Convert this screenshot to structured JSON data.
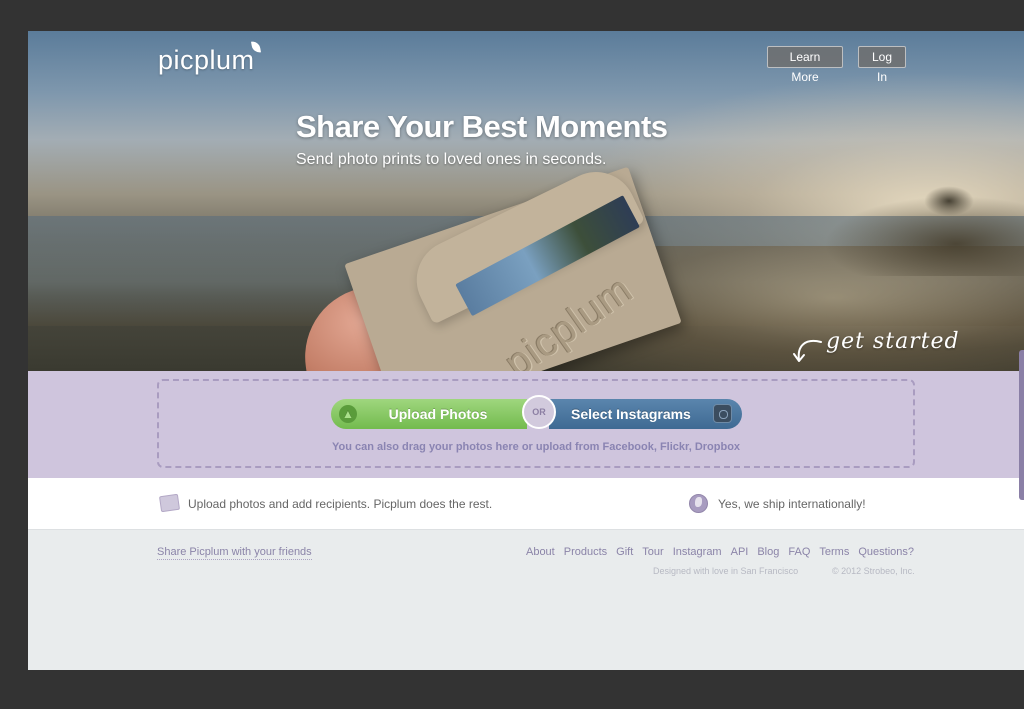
{
  "header": {
    "logo": "picplum",
    "learn_more": "Learn More",
    "log_in": "Log In"
  },
  "hero": {
    "title": "Share Your Best Moments",
    "subtitle": "Send photo prints to loved ones in seconds.",
    "card_brand": "picplum",
    "get_started": "get started"
  },
  "upload": {
    "upload_photos": "Upload Photos",
    "or": "OR",
    "select_instagrams": "Select Instagrams",
    "drag_text": "You can also drag your photos here or upload from Facebook, Flickr, Dropbox"
  },
  "info": {
    "left": "Upload photos and add recipients. Picplum does the rest.",
    "right": "Yes, we ship internationally!"
  },
  "footer": {
    "share": "Share Picplum with your friends",
    "nav": [
      "About",
      "Products",
      "Gift",
      "Tour",
      "Instagram",
      "API",
      "Blog",
      "FAQ",
      "Terms",
      "Questions?"
    ],
    "designed": "Designed with love in San Francisco",
    "copyright": "© 2012 Strobeo, Inc."
  }
}
